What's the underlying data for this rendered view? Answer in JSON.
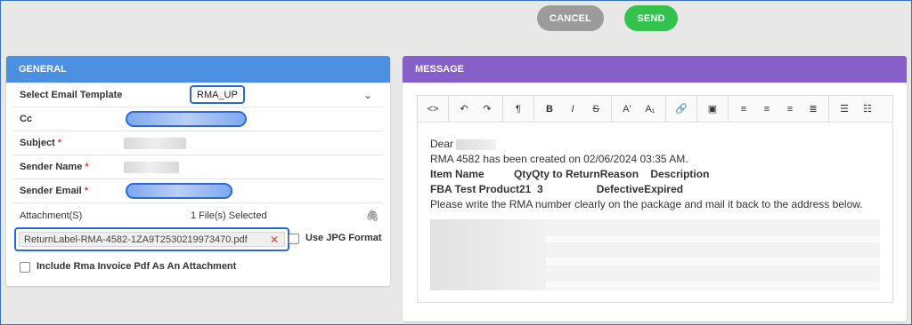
{
  "actions": {
    "cancel": "CANCEL",
    "send": "SEND"
  },
  "general": {
    "title": "GENERAL",
    "template_label": "Select Email Template",
    "template_value": "RMA_UP",
    "cc_label": "Cc",
    "subject_label": "Subject",
    "sender_name_label": "Sender Name",
    "sender_email_label": "Sender Email",
    "required_mark": "*",
    "attachments_label": "Attachment(S)",
    "files_selected": "1 File(s) Selected",
    "attachment_file": "ReturnLabel-RMA-4582-1ZA9T2530219973470.pdf",
    "use_jpg_label": "Use JPG Format",
    "include_invoice_label": "Include Rma Invoice Pdf As An Attachment"
  },
  "message": {
    "title": "MESSAGE",
    "toolbar": [
      "<>",
      "↶",
      "↷",
      "¶",
      "B",
      "I",
      "S",
      "A'",
      "A₁",
      "link",
      "image",
      "align-left",
      "align-center",
      "align-right",
      "align-justify",
      "bullet-list",
      "numbered-list"
    ],
    "greeting": "Dear",
    "line1": "RMA 4582 has been created on 02/06/2024 03:35 AM.",
    "header_row": "Item Name          QtyQty to ReturnReason    Description",
    "item_row": "FBA Test Product21  3                  DefectiveExpired",
    "line2": "Please write the RMA number clearly on the package and mail it back to the address below."
  },
  "colors": {
    "general_header": "#4a8fe0",
    "message_header": "#8660c8",
    "send": "#32c24d",
    "cancel": "#9b9b9b",
    "highlight": "#2a6ad4"
  }
}
